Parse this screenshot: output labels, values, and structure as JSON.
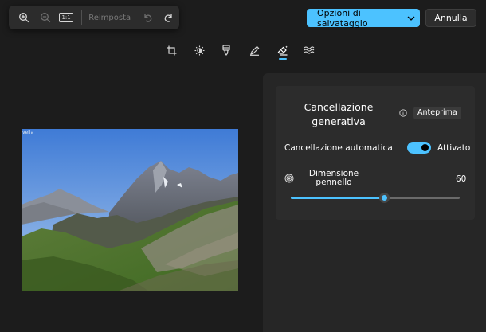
{
  "toolbar": {
    "zoom_in_icon": "zoom-in-icon",
    "zoom_out_icon": "zoom-out-icon",
    "actual_size_label": "1:1",
    "reset_label": "Reimposta",
    "undo_icon": "undo-icon",
    "redo_icon": "redo-icon"
  },
  "header": {
    "save_options_label": "Opzioni di salvataggio",
    "cancel_label": "Annulla"
  },
  "tools": {
    "items": [
      "crop-icon",
      "brightness-icon",
      "filter-icon",
      "markup-icon",
      "erase-icon",
      "background-icon"
    ],
    "active": "erase-icon"
  },
  "photo": {
    "caption": "vella"
  },
  "panel": {
    "title": "Cancellazione generativa",
    "preview_label": "Anteprima",
    "auto_erase_label": "Cancellazione automatica",
    "auto_erase_on": true,
    "auto_erase_state": "Attivato",
    "brush_size_label": "Dimensione pennello",
    "brush_size_value": "60",
    "brush_size_fraction": 0.55
  },
  "colors": {
    "accent": "#4cc2ff",
    "background": "#1c1c1c",
    "panel": "#262626",
    "card": "#2c2c2c"
  }
}
